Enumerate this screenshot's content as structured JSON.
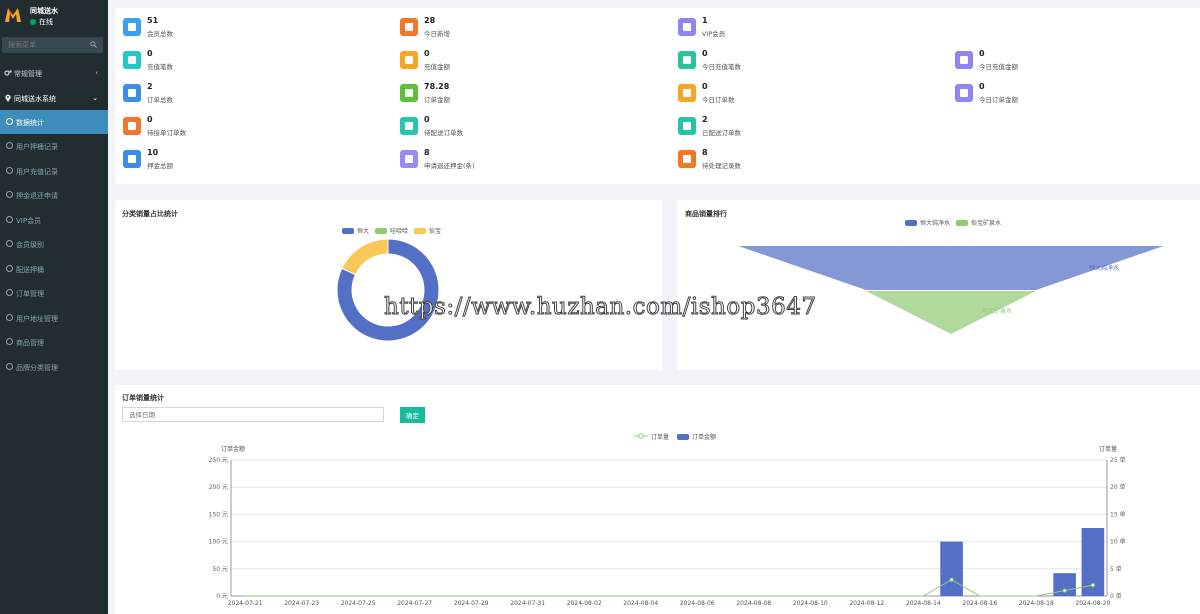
{
  "sidebar": {
    "brand_name": "同城送水",
    "status": "在线",
    "search_placeholder": "搜索菜单",
    "groups": [
      {
        "label": "常规管理",
        "caret": "‹"
      },
      {
        "label": "同城送水系统",
        "caret": "⌄"
      }
    ],
    "items": [
      {
        "label": "数据统计"
      },
      {
        "label": "用户押桶记录"
      },
      {
        "label": "用户充值记录"
      },
      {
        "label": "押金退还申请"
      },
      {
        "label": "VIP会员"
      },
      {
        "label": "会员级别"
      },
      {
        "label": "配送押桶"
      },
      {
        "label": "订单管理"
      },
      {
        "label": "用户地址管理"
      },
      {
        "label": "商品管理"
      },
      {
        "label": "品牌分类管理"
      }
    ],
    "active_index": 0
  },
  "stats": [
    {
      "value": "51",
      "label": "会员总数",
      "color": "#3c9ff0",
      "icon": "user-icon"
    },
    {
      "value": "28",
      "label": "今日新增",
      "color": "#f2772a",
      "icon": "user-icon"
    },
    {
      "value": "1",
      "label": "VIP会员",
      "color": "#8e86f5",
      "icon": "user-icon"
    },
    {
      "value": "0",
      "label": "充值笔数",
      "color": "#26c6c6",
      "icon": "wallet-icon"
    },
    {
      "value": "0",
      "label": "充值金额",
      "color": "#f5a623",
      "icon": "wallet-icon"
    },
    {
      "value": "0",
      "label": "今日充值笔数",
      "color": "#27c49d",
      "icon": "wallet-icon"
    },
    {
      "value": "0",
      "label": "今日充值金额",
      "color": "#8e86f5",
      "icon": "wallet-icon"
    },
    {
      "value": "2",
      "label": "订单总数",
      "color": "#3c8de8",
      "icon": "order-icon"
    },
    {
      "value": "78.28",
      "label": "订单金额",
      "color": "#5bc236",
      "icon": "order-icon"
    },
    {
      "value": "0",
      "label": "今日订单数",
      "color": "#f5a623",
      "icon": "order-icon"
    },
    {
      "value": "0",
      "label": "今日订单金额",
      "color": "#8e86f5",
      "icon": "order-icon"
    },
    {
      "value": "0",
      "label": "待接单订单数",
      "color": "#f2772a",
      "icon": "order-icon"
    },
    {
      "value": "0",
      "label": "待配送订单数",
      "color": "#27c4b0",
      "icon": "order-icon"
    },
    {
      "value": "2",
      "label": "已配送订单数",
      "color": "#27c4a7",
      "icon": "order-icon"
    },
    {
      "value": "10",
      "label": "押金总额",
      "color": "#3c8de8",
      "icon": "deposit-icon"
    },
    {
      "value": "8",
      "label": "申请退还押金(条)",
      "color": "#9b8af0",
      "icon": "deposit-icon"
    },
    {
      "value": "8",
      "label": "待处理记录数",
      "color": "#f2772a",
      "icon": "deposit-icon"
    }
  ],
  "category_chart": {
    "title": "分类销量占比统计",
    "chart_data": {
      "type": "pie",
      "categories": [
        "恒大",
        "哇哈哈",
        "怡宝"
      ],
      "values": [
        82,
        0,
        18
      ],
      "colors": [
        "#5470c6",
        "#91cc75",
        "#fac858"
      ],
      "legend_position": "top"
    }
  },
  "funnel_chart": {
    "title": "商品销量排行",
    "chart_data": {
      "type": "funnel",
      "categories": [
        "恒大纯净水",
        "怡宝矿泉水"
      ],
      "values": [
        100,
        40
      ],
      "colors": [
        "#5470c6",
        "#91cc75"
      ],
      "legend_position": "top"
    }
  },
  "order_chart": {
    "title": "订单销量统计",
    "date_placeholder": "选择日期",
    "confirm_label": "确定",
    "chart_data": {
      "type": "bar",
      "x": [
        "2024-07-21",
        "2024-07-22",
        "2024-07-23",
        "2024-07-24",
        "2024-07-25",
        "2024-07-26",
        "2024-07-27",
        "2024-07-28",
        "2024-07-29",
        "2024-07-30",
        "2024-07-31",
        "2024-08-01",
        "2024-08-02",
        "2024-08-03",
        "2024-08-04",
        "2024-08-05",
        "2024-08-06",
        "2024-08-07",
        "2024-08-08",
        "2024-08-09",
        "2024-08-10",
        "2024-08-11",
        "2024-08-12",
        "2024-08-13",
        "2024-08-14",
        "2024-08-15",
        "2024-08-16",
        "2024-08-17",
        "2024-08-18",
        "2024-08-19",
        "2024-08-20"
      ],
      "x_tick_labels": [
        "2024-07-21",
        "2024-07-23",
        "2024-07-25",
        "2024-07-27",
        "2024-07-29",
        "2024-07-31",
        "2024-08-02",
        "2024-08-04",
        "2024-08-06",
        "2024-08-08",
        "2024-08-10",
        "2024-08-12",
        "2024-08-14",
        "2024-08-16",
        "2024-08-18",
        "2024-08-20"
      ],
      "series": [
        {
          "name": "订单量",
          "type": "line",
          "axis": "right",
          "color": "#91cc75",
          "values": [
            0,
            0,
            0,
            0,
            0,
            0,
            0,
            0,
            0,
            0,
            0,
            0,
            0,
            0,
            0,
            0,
            0,
            0,
            0,
            0,
            0,
            0,
            0,
            0,
            0,
            3,
            0,
            0,
            0,
            1,
            2
          ]
        },
        {
          "name": "订单金额",
          "type": "bar",
          "axis": "left",
          "color": "#5470c6",
          "values": [
            0,
            0,
            0,
            0,
            0,
            0,
            0,
            0,
            0,
            0,
            0,
            0,
            0,
            0,
            0,
            0,
            0,
            0,
            0,
            0,
            0,
            0,
            0,
            0,
            0,
            100,
            0,
            0,
            0,
            42,
            125
          ]
        }
      ],
      "ylabel_left": "订单金额",
      "ylabel_right": "订单量",
      "ylim_left": [
        0,
        250
      ],
      "ylim_right": [
        0,
        25
      ],
      "left_ticks": [
        "0 元",
        "50 元",
        "100 元",
        "150 元",
        "200 元",
        "250 元"
      ],
      "right_ticks": [
        "0 单",
        "5 单",
        "10 单",
        "15 单",
        "20 单",
        "25 单"
      ],
      "grid": true,
      "legend_position": "top"
    }
  },
  "watermark": "https://www.huzhan.com/ishop3647"
}
